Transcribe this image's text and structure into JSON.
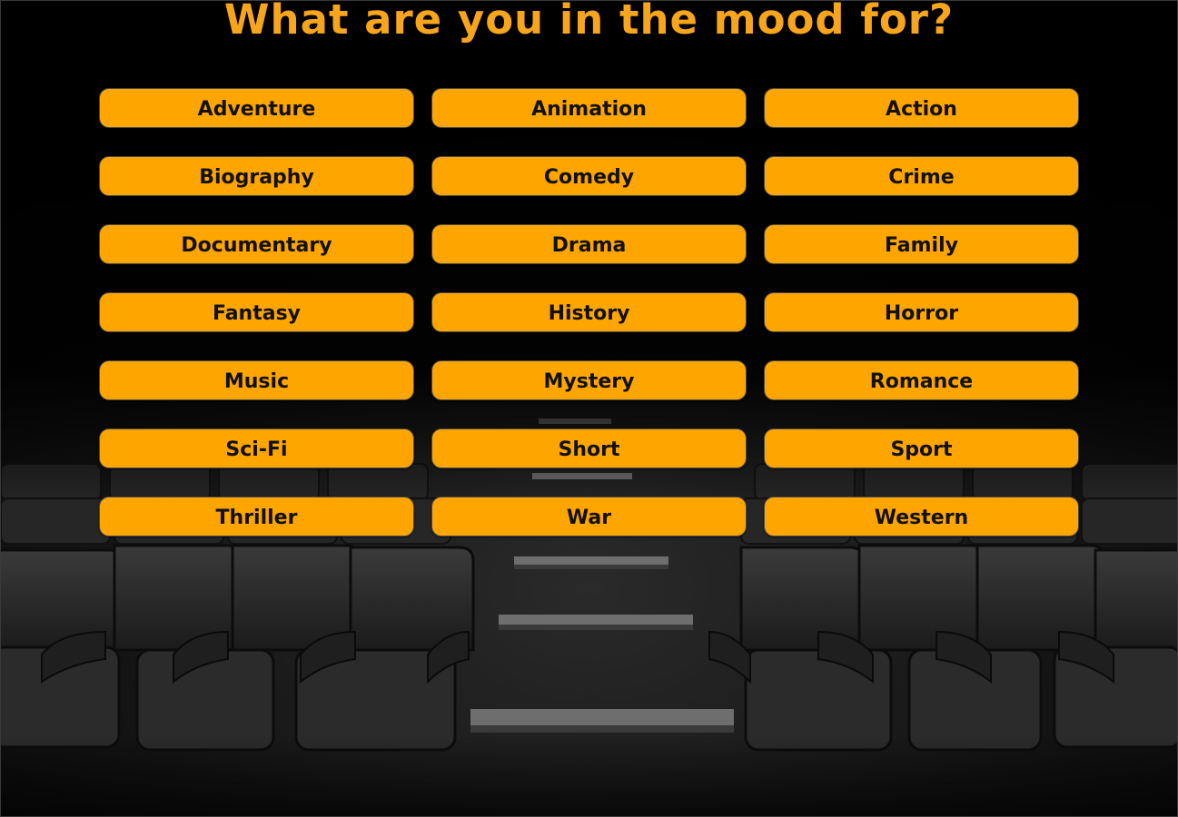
{
  "heading": "What are you in the mood for?",
  "colors": {
    "accent": "#ffa500",
    "title": "#f7a51c",
    "background": "#000000",
    "button_text": "#111111"
  },
  "genres": [
    "Adventure",
    "Animation",
    "Action",
    "Biography",
    "Comedy",
    "Crime",
    "Documentary",
    "Drama",
    "Family",
    "Fantasy",
    "History",
    "Horror",
    "Music",
    "Mystery",
    "Romance",
    "Sci-Fi",
    "Short",
    "Sport",
    "Thriller",
    "War",
    "Western"
  ]
}
